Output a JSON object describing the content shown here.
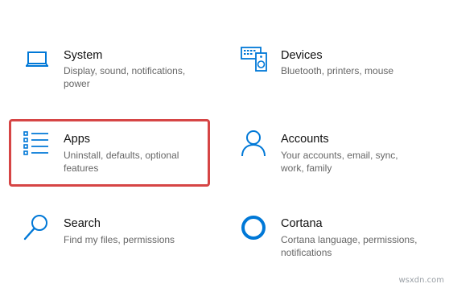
{
  "tiles": [
    {
      "key": "system",
      "title": "System",
      "desc": "Display, sound, notifications, power",
      "icon": "laptop-icon"
    },
    {
      "key": "devices",
      "title": "Devices",
      "desc": "Bluetooth, printers, mouse",
      "icon": "devices-icon"
    },
    {
      "key": "apps",
      "title": "Apps",
      "desc": "Uninstall, defaults, optional features",
      "icon": "apps-list-icon",
      "highlighted": true
    },
    {
      "key": "accounts",
      "title": "Accounts",
      "desc": "Your accounts, email, sync, work, family",
      "icon": "person-icon"
    },
    {
      "key": "search",
      "title": "Search",
      "desc": "Find my files, permissions",
      "icon": "search-icon"
    },
    {
      "key": "cortana",
      "title": "Cortana",
      "desc": "Cortana language, permissions, notifications",
      "icon": "cortana-icon"
    }
  ],
  "colors": {
    "accent": "#0078d7",
    "highlight": "#d64545",
    "text": "#111111",
    "secondary": "#666666"
  },
  "watermark": "wsxdn.com"
}
